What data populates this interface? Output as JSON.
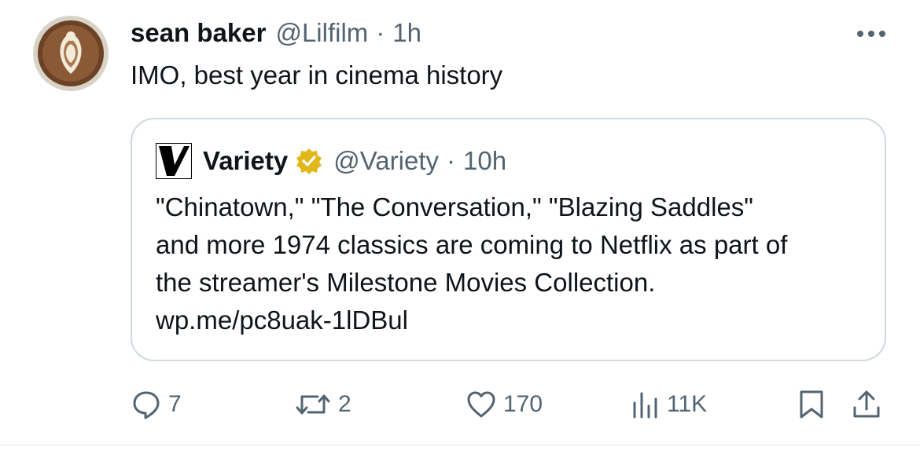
{
  "tweet": {
    "author_name": "sean baker",
    "author_handle": "@Lilfilm",
    "separator": "·",
    "time": "1h",
    "text": "IMO, best year in cinema history",
    "avatar_icon": "latte-art-avatar",
    "more_icon": "more-dots-icon"
  },
  "quote": {
    "author_name": "Variety",
    "author_handle": "@Variety",
    "separator": "·",
    "time": "10h",
    "verified_color": "#e2b719",
    "text_lines": [
      "\"Chinatown,\" \"The Conversation,\" \"Blazing Saddles\"",
      "and more 1974 classics are coming to Netflix as part of",
      "the streamer's Milestone Movies Collection.",
      "wp.me/pc8uak-1lDBul"
    ]
  },
  "actions": {
    "reply_count": "7",
    "retweet_count": "2",
    "like_count": "170",
    "views_count": "11K",
    "icon_color": "#536471"
  }
}
